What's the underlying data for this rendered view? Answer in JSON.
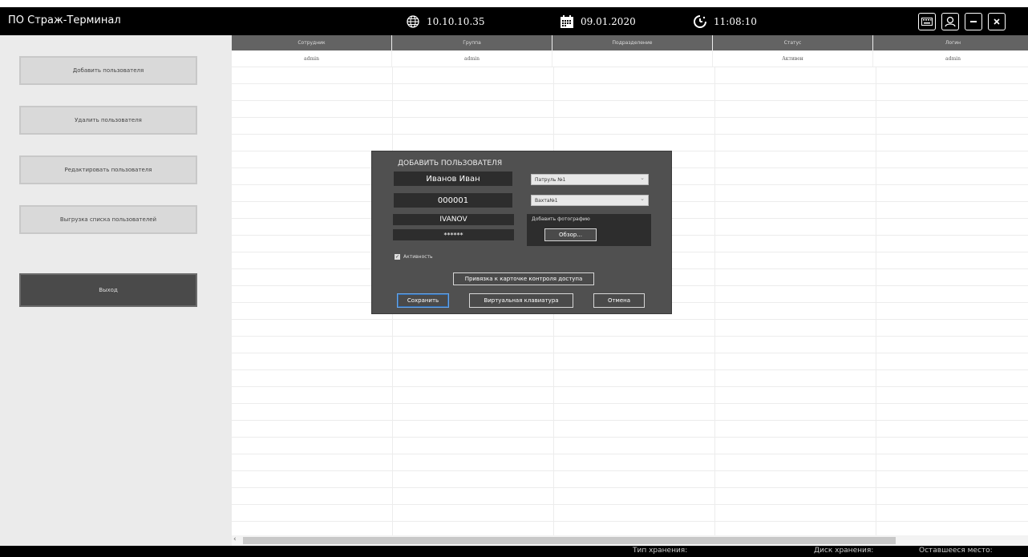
{
  "app": {
    "title": "ПО Страж-Терминал"
  },
  "topbar": {
    "ip": "10.10.10.35",
    "date": "09.01.2020",
    "time": "11:08:10"
  },
  "sidebar": {
    "items": [
      {
        "label": "Добавить пользователя"
      },
      {
        "label": "Удалить пользователя"
      },
      {
        "label": "Редактировать пользователя"
      },
      {
        "label": "Выгрузка списка пользователей"
      },
      {
        "label": "Выход"
      }
    ]
  },
  "table": {
    "headers": [
      "Сотрудник",
      "Группа",
      "Подразделение",
      "Статус",
      "Логин"
    ],
    "rows": [
      [
        "admin",
        "admin",
        "",
        "Активен",
        "admin"
      ]
    ]
  },
  "dialog": {
    "title": "ДОБАВИТЬ ПОЛЬЗОВАТЕЛЯ",
    "name_value": "Иванов Иван",
    "id_value": "000001",
    "login_value": "IVANOV",
    "password_value": "******",
    "group_select": "Патруль №1",
    "shift_select": "Вахта№1",
    "photo_label": "Добавить фотографию",
    "browse_label": "Обзор...",
    "active_label": "Активность",
    "card_binding_label": "Привязка к карточке контроля доступа",
    "save_label": "Сохранить",
    "keyboard_label": "Виртуальная клавиатура",
    "cancel_label": "Отмена"
  },
  "statusbar": {
    "storage_type_label": "Тип хранения:",
    "storage_disk_label": "Диск хранения:",
    "free_space_label": "Оставшееся место:"
  }
}
